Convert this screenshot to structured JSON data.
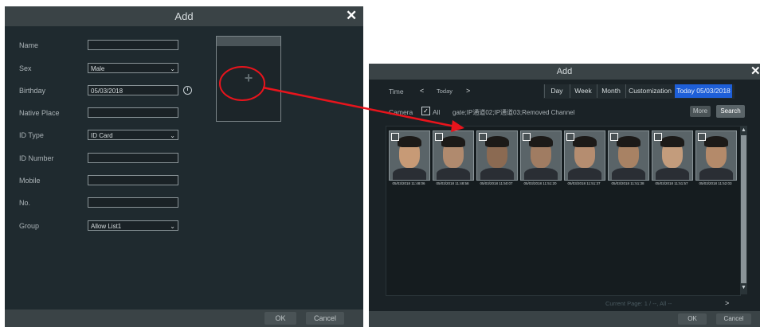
{
  "add_dialog": {
    "title": "Add",
    "fields": [
      {
        "label": "Name",
        "value": ""
      },
      {
        "label": "Sex",
        "value": "Male",
        "type": "select"
      },
      {
        "label": "Birthday",
        "value": "05/03/2018",
        "type": "date"
      },
      {
        "label": "Native Place",
        "value": ""
      },
      {
        "label": "ID Type",
        "value": "ID Card",
        "type": "select"
      },
      {
        "label": "ID Number",
        "value": ""
      },
      {
        "label": "Mobile",
        "value": ""
      },
      {
        "label": "No.",
        "value": ""
      },
      {
        "label": "Group",
        "value": "Allow List1",
        "type": "select"
      }
    ],
    "photo_add_symbol": "+",
    "ok_label": "OK",
    "cancel_label": "Cancel"
  },
  "search_dialog": {
    "title": "Add",
    "time_label": "Time",
    "prev_symbol": "<",
    "today_label": "Today",
    "next_symbol": ">",
    "range_tabs": [
      "Day",
      "Week",
      "Month",
      "Customization"
    ],
    "active_date": "Today 05/03/2018",
    "camera_label": "Camera",
    "all_label": "All",
    "channels_text": "gate;IP通道02;IP通道03;Removed Channel",
    "more_label": "More",
    "search_label": "Search",
    "timestamps": [
      "05/03/2018 11:48:06",
      "05/03/2018 11:48:58",
      "05/03/2018 11:50:07",
      "05/03/2018 11:51:20",
      "05/03/2018 11:51:37",
      "05/03/2018 11:51:38",
      "05/03/2018 11:51:57",
      "05/03/2018 11:52:03"
    ],
    "pagination_text": "Current Page: 1 / --, All --",
    "ok_label": "OK",
    "cancel_label": "Cancel"
  },
  "colors": {
    "dialog_bg": "#1f2a2f",
    "titlebar_bg": "#3a4346",
    "accent_blue": "#1e5fd8",
    "annotation_red": "#e8141c"
  }
}
